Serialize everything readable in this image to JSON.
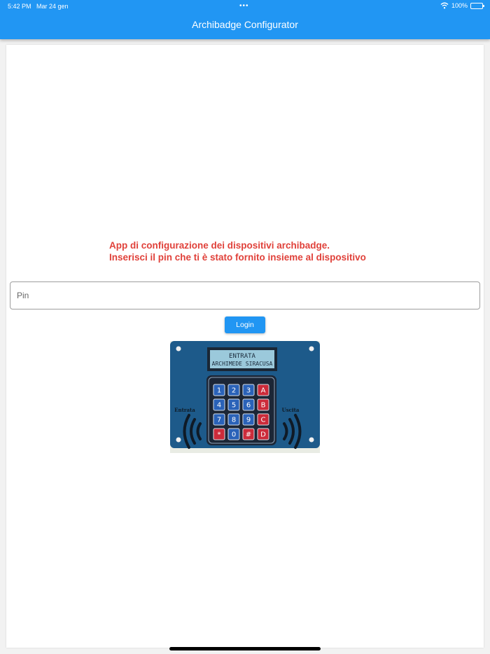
{
  "status_bar": {
    "time": "5:42 PM",
    "date": "Mar 24 gen",
    "dots": "•••",
    "battery": "100%"
  },
  "appbar": {
    "title": "Archibadge Configurator"
  },
  "main": {
    "message_line1": "App di configurazione dei dispositivi archibadge.",
    "message_line2": "Inserisci il pin che ti è stato fornito insieme al dispositivo",
    "pin_placeholder": "Pin",
    "pin_value": "",
    "login_label": "Login"
  },
  "device": {
    "lcd_line1": "ENTRATA",
    "lcd_line2": "ARCHIMEDE SIRACUSA",
    "left_label": "Entrata",
    "right_label": "Uscita",
    "keys": [
      [
        "1",
        "2",
        "3",
        "A"
      ],
      [
        "4",
        "5",
        "6",
        "B"
      ],
      [
        "7",
        "8",
        "9",
        "C"
      ],
      [
        "*",
        "0",
        "#",
        "D"
      ]
    ]
  },
  "colors": {
    "primary": "#2196f3",
    "message": "#e0413a",
    "device_board": "#1d5a8a",
    "key_blue": "#2a62b8",
    "key_red": "#cc2b3a"
  }
}
